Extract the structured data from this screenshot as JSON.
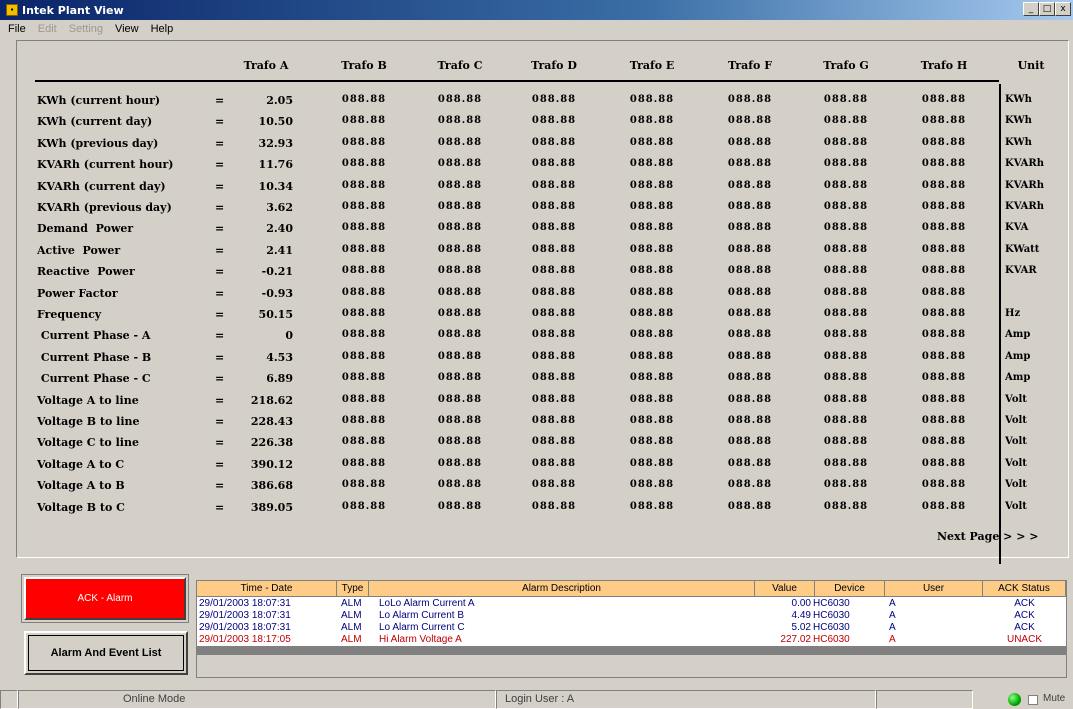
{
  "window": {
    "title": "Intek Plant View",
    "buttons": [
      "_",
      "□",
      "x"
    ]
  },
  "menu": [
    {
      "label": "File",
      "enabled": true
    },
    {
      "label": "Edit",
      "enabled": false
    },
    {
      "label": "Setting",
      "enabled": false
    },
    {
      "label": "View",
      "enabled": true
    },
    {
      "label": "Help",
      "enabled": true
    }
  ],
  "grid": {
    "headers": [
      "Trafo A",
      "Trafo B",
      "Trafo C",
      "Trafo D",
      "Trafo E",
      "Trafo F",
      "Trafo G",
      "Trafo H"
    ],
    "unit_header": "Unit",
    "placeholder": "088.88",
    "rows": [
      {
        "label": "KWh (current hour)",
        "eq": "=",
        "value": "2.05",
        "unit": "KWh"
      },
      {
        "label": "KWh (current day)",
        "eq": "=",
        "value": "10.50",
        "unit": "KWh"
      },
      {
        "label": "KWh (previous day)",
        "eq": "=",
        "value": "32.93",
        "unit": "KWh"
      },
      {
        "label": "KVARh (current hour)",
        "eq": "=",
        "value": "11.76",
        "unit": "KVARh"
      },
      {
        "label": "KVARh (current day)",
        "eq": "=",
        "value": "10.34",
        "unit": "KVARh"
      },
      {
        "label": "KVARh (previous day)",
        "eq": "=",
        "value": "3.62",
        "unit": "KVARh"
      },
      {
        "label": "Demand  Power",
        "eq": "=",
        "value": "2.40",
        "unit": "KVA"
      },
      {
        "label": "Active  Power",
        "eq": "=",
        "value": "2.41",
        "unit": "KWatt"
      },
      {
        "label": "Reactive  Power",
        "eq": "=",
        "value": "-0.21",
        "unit": "KVAR"
      },
      {
        "label": "Power Factor",
        "eq": "=",
        "value": "-0.93",
        "unit": ""
      },
      {
        "label": "Frequency",
        "eq": "=",
        "value": "50.15",
        "unit": "Hz"
      },
      {
        "label": " Current Phase - A",
        "eq": "=",
        "value": "0",
        "unit": "Amp"
      },
      {
        "label": " Current Phase - B",
        "eq": "=",
        "value": "4.53",
        "unit": "Amp"
      },
      {
        "label": " Current Phase - C",
        "eq": "=",
        "value": "6.89",
        "unit": "Amp"
      },
      {
        "label": "Voltage A to line",
        "eq": "=",
        "value": "218.62",
        "unit": "Volt"
      },
      {
        "label": "Voltage B to line",
        "eq": "=",
        "value": "228.43",
        "unit": "Volt"
      },
      {
        "label": "Voltage C to line",
        "eq": "=",
        "value": "226.38",
        "unit": "Volt"
      },
      {
        "label": "Voltage A to C",
        "eq": "=",
        "value": "390.12",
        "unit": "Volt"
      },
      {
        "label": "Voltage A to B",
        "eq": "=",
        "value": "386.68",
        "unit": "Volt"
      },
      {
        "label": "Voltage B to C",
        "eq": "=",
        "value": "389.05",
        "unit": "Volt"
      }
    ],
    "next_page": "Next Page > > >"
  },
  "alarm": {
    "ack_button": "ACK - Alarm",
    "list_button": "Alarm And Event List",
    "ack_color": "#ff0000",
    "columns": [
      "Time - Date",
      "Type",
      "Alarm Description",
      "Value",
      "Device",
      "User",
      "ACK Status"
    ],
    "rows": [
      {
        "time": "29/01/2003 18:07:31",
        "type": "ALM",
        "desc": "LoLo Alarm Current A",
        "value": "0.00",
        "device": "HC6030",
        "user": "A",
        "status": "ACK",
        "color": "#000080"
      },
      {
        "time": "29/01/2003 18:07:31",
        "type": "ALM",
        "desc": "Lo Alarm Current B",
        "value": "4.49",
        "device": "HC6030",
        "user": "A",
        "status": "ACK",
        "color": "#000080"
      },
      {
        "time": "29/01/2003 18:07:31",
        "type": "ALM",
        "desc": "Lo Alarm Current C",
        "value": "5.02",
        "device": "HC6030",
        "user": "A",
        "status": "ACK",
        "color": "#000080"
      },
      {
        "time": "29/01/2003 18:17:05",
        "type": "ALM",
        "desc": "Hi Alarm Voltage A",
        "value": "227.02",
        "device": "HC6030",
        "user": "A",
        "status": "UNACK",
        "color": "#c00000"
      }
    ]
  },
  "status": {
    "mode": "Online Mode",
    "login": "Login User : A",
    "mute": "Mute",
    "led_color": "#00a000"
  }
}
